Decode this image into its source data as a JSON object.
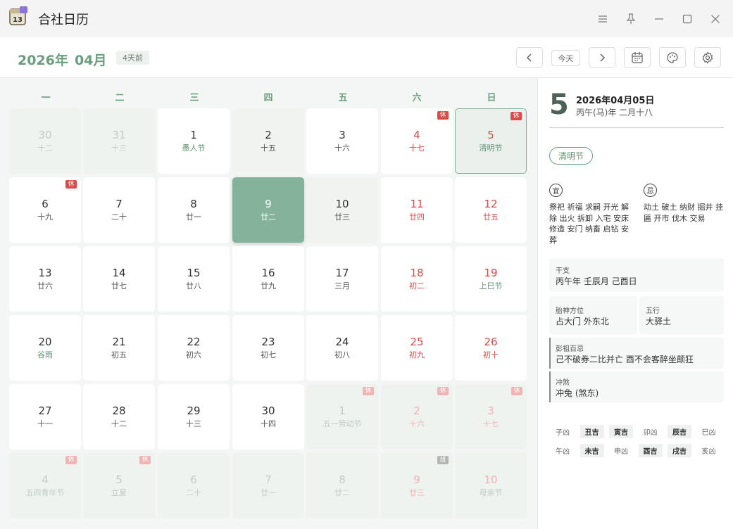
{
  "app": {
    "title": "合社日历",
    "icon_label": "13"
  },
  "toolbar": {
    "year": "2026年",
    "month": "04月",
    "relative": "4天前",
    "today_label": "今天"
  },
  "weekdays": [
    "一",
    "二",
    "三",
    "四",
    "五",
    "六",
    "日"
  ],
  "days": [
    {
      "n": "30",
      "l": "十二",
      "cls": "dim"
    },
    {
      "n": "31",
      "l": "十三",
      "cls": "dim"
    },
    {
      "n": "1",
      "l": "愚人节",
      "cls": "fest"
    },
    {
      "n": "2",
      "l": "十五",
      "cls": "gray"
    },
    {
      "n": "3",
      "l": "十六",
      "cls": ""
    },
    {
      "n": "4",
      "l": "十七",
      "cls": "red",
      "b": "休"
    },
    {
      "n": "5",
      "l": "清明节",
      "cls": "red fest sel",
      "b": "休"
    },
    {
      "n": "6",
      "l": "十九",
      "cls": "",
      "b": "休"
    },
    {
      "n": "7",
      "l": "二十",
      "cls": ""
    },
    {
      "n": "8",
      "l": "廿一",
      "cls": ""
    },
    {
      "n": "9",
      "l": "廿二",
      "cls": "today"
    },
    {
      "n": "10",
      "l": "廿三",
      "cls": "gray"
    },
    {
      "n": "11",
      "l": "廿四",
      "cls": "red"
    },
    {
      "n": "12",
      "l": "廿五",
      "cls": "red"
    },
    {
      "n": "13",
      "l": "廿六",
      "cls": ""
    },
    {
      "n": "14",
      "l": "廿七",
      "cls": ""
    },
    {
      "n": "15",
      "l": "廿八",
      "cls": ""
    },
    {
      "n": "16",
      "l": "廿九",
      "cls": ""
    },
    {
      "n": "17",
      "l": "三月",
      "cls": ""
    },
    {
      "n": "18",
      "l": "初二",
      "cls": "red"
    },
    {
      "n": "19",
      "l": "上巳节",
      "cls": "red fest"
    },
    {
      "n": "20",
      "l": "谷雨",
      "cls": "fest"
    },
    {
      "n": "21",
      "l": "初五",
      "cls": ""
    },
    {
      "n": "22",
      "l": "初六",
      "cls": ""
    },
    {
      "n": "23",
      "l": "初七",
      "cls": ""
    },
    {
      "n": "24",
      "l": "初八",
      "cls": ""
    },
    {
      "n": "25",
      "l": "初九",
      "cls": "red"
    },
    {
      "n": "26",
      "l": "初十",
      "cls": "red"
    },
    {
      "n": "27",
      "l": "十一",
      "cls": ""
    },
    {
      "n": "28",
      "l": "十二",
      "cls": ""
    },
    {
      "n": "29",
      "l": "十三",
      "cls": ""
    },
    {
      "n": "30",
      "l": "十四",
      "cls": ""
    },
    {
      "n": "1",
      "l": "五一劳动节",
      "cls": "dim fest",
      "b": "休"
    },
    {
      "n": "2",
      "l": "十六",
      "cls": "dim red",
      "b": "休"
    },
    {
      "n": "3",
      "l": "十七",
      "cls": "dim red",
      "b": "休"
    },
    {
      "n": "4",
      "l": "五四青年节",
      "cls": "dim fest",
      "b": "休"
    },
    {
      "n": "5",
      "l": "立夏",
      "cls": "dim fest",
      "b": "休"
    },
    {
      "n": "6",
      "l": "二十",
      "cls": "dim"
    },
    {
      "n": "7",
      "l": "廿一",
      "cls": "dim"
    },
    {
      "n": "8",
      "l": "廿二",
      "cls": "dim"
    },
    {
      "n": "9",
      "l": "廿三",
      "cls": "dim red",
      "b": "班",
      "bw": true
    },
    {
      "n": "10",
      "l": "母亲节",
      "cls": "dim red fest"
    }
  ],
  "detail": {
    "day": "5",
    "full_date": "2026年04月05日",
    "lunar": "丙午(马)年 二月十八",
    "festival": "清明节",
    "yi_icon": "宜",
    "ji_icon": "忌",
    "yi_lines": [
      "祭祀 祈福 求嗣 开光 解",
      "除 出火 拆卸 入宅 安床",
      "修造 安门 纳畜 启钻 安",
      "葬"
    ],
    "ji_lines": [
      "动土 破土 纳财 掘井 挂",
      "匾 开市 伐木 交易"
    ],
    "ganzhi_label": "干支",
    "ganzhi": "丙午年 壬辰月 己酉日",
    "taishen_label": "胎神方位",
    "taishen": "占大门 外东北",
    "wuxing_label": "五行",
    "wuxing": "大驿土",
    "pengzu_label": "彭祖百忌",
    "pengzu": "己不破券二比并亡 酉不会客醉坐颠狂",
    "chongsha_label": "冲煞",
    "chongsha": "冲兔 (煞东)",
    "hours": [
      {
        "t": "子凶",
        "ji": false
      },
      {
        "t": "丑吉",
        "ji": true
      },
      {
        "t": "寅吉",
        "ji": true
      },
      {
        "t": "卯凶",
        "ji": false
      },
      {
        "t": "辰吉",
        "ji": true
      },
      {
        "t": "巳凶",
        "ji": false
      },
      {
        "t": "午凶",
        "ji": false
      },
      {
        "t": "未吉",
        "ji": true
      },
      {
        "t": "申凶",
        "ji": false
      },
      {
        "t": "酉吉",
        "ji": true
      },
      {
        "t": "戌吉",
        "ji": true
      },
      {
        "t": "亥凶",
        "ji": false
      }
    ]
  },
  "icons": [
    "calendar-app-icon",
    "menu-icon",
    "pin-icon",
    "minimize-icon",
    "maximize-icon",
    "close-icon",
    "chevron-left-icon",
    "chevron-right-icon",
    "calendar-icon",
    "palette-icon",
    "gear-icon"
  ]
}
